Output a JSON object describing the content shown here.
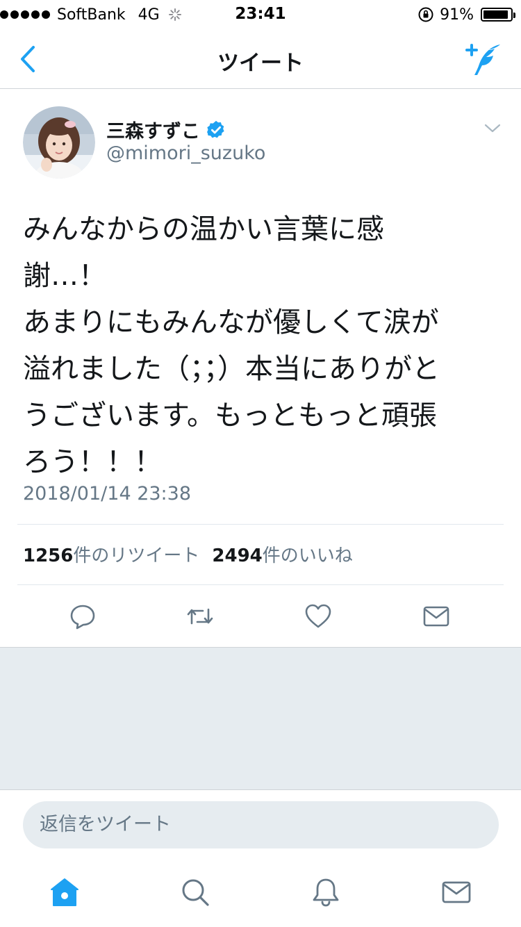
{
  "status_bar": {
    "carrier": "SoftBank",
    "network": "4G",
    "time": "23:41",
    "battery_percent": "91%",
    "battery_level": 0.91
  },
  "nav": {
    "title": "ツイート",
    "back_icon": "chevron-left-icon",
    "compose_icon": "compose-tweet-icon"
  },
  "tweet": {
    "display_name": "三森すずこ",
    "handle": "@mimori_suzuko",
    "verified": true,
    "text": "みんなからの温かい言葉に感\n謝…！\nあまりにもみんなが優しくて涙が\n溢れました（；；）本当にありがと\nうございます。もっともっと頑張\nろう！！！",
    "timestamp": "2018/01/14 23:38",
    "retweet_count": "1256",
    "retweet_label": "件のリツイート",
    "like_count": "2494",
    "like_label": "件のいいね"
  },
  "reply": {
    "placeholder": "返信をツイート"
  },
  "tabs": [
    {
      "icon": "home-icon",
      "active": true
    },
    {
      "icon": "search-icon",
      "active": false
    },
    {
      "icon": "notifications-bell-icon",
      "active": false
    },
    {
      "icon": "messages-envelope-icon",
      "active": false
    }
  ],
  "colors": {
    "accent": "#1da1f2",
    "text_primary": "#14171a",
    "text_secondary": "#657786",
    "icon_gray": "#657786",
    "background_gray": "#e6ecf0"
  }
}
